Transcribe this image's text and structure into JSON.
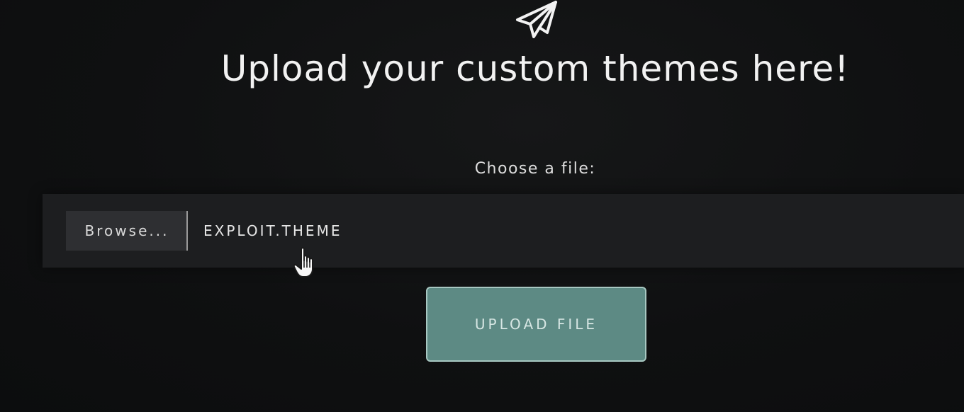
{
  "header": {
    "icon": "paper-plane-icon",
    "title": "Upload your custom themes here!"
  },
  "form": {
    "choose_label": "Choose a file:",
    "browse_label": "Browse...",
    "selected_file": "EXPLOIT.THEME",
    "upload_label": "UPLOAD FILE"
  },
  "cursor": {
    "icon": "hand-pointer-icon"
  },
  "colors": {
    "background": "#0f1011",
    "file_row": "#1d1e20",
    "browse_button": "#2e2f32",
    "upload_button": "#5d8a84",
    "upload_border": "#a7c7c1"
  }
}
